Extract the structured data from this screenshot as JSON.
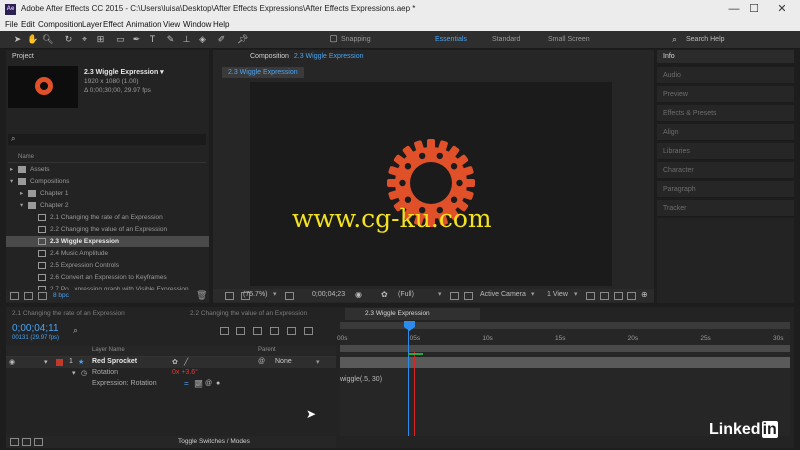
{
  "window": {
    "title": "Adobe After Effects CC 2015 - C:\\Users\\luisa\\Desktop\\After Effects Expressions\\After Effects Expressions.aep *",
    "app_icon": "Ae",
    "controls": [
      "—",
      "☐",
      "✕"
    ]
  },
  "menu": [
    "File",
    "Edit",
    "Composition",
    "Layer",
    "Effect",
    "Animation",
    "View",
    "Window",
    "Help"
  ],
  "toolbar": {
    "snapping_label": "Snapping",
    "workspaces": [
      "Essentials",
      "Standard",
      "Small Screen"
    ],
    "search_help": "Search Help"
  },
  "project": {
    "panel_title": "Project",
    "comp_name": "2.3    Wiggle Expression ▾",
    "comp_size": "1920 x 1080 (1.00)",
    "comp_duration": "Δ 0;00;30;00, 29.97 fps",
    "search_placeholder": "",
    "column_name": "Name",
    "tree": [
      {
        "label": "Assets",
        "indent": 0,
        "arrow": "▸",
        "kind": "folder"
      },
      {
        "label": "Compositions",
        "indent": 0,
        "arrow": "▾",
        "kind": "folder"
      },
      {
        "label": "Chapter 1",
        "indent": 1,
        "arrow": "▸",
        "kind": "folder"
      },
      {
        "label": "Chapter 2",
        "indent": 1,
        "arrow": "▾",
        "kind": "folder"
      },
      {
        "label": "2.1   Changing the rate of an Expression",
        "indent": 2,
        "arrow": "",
        "kind": "comp"
      },
      {
        "label": "2.2   Changing the value of an Expression",
        "indent": 2,
        "arrow": "",
        "kind": "comp"
      },
      {
        "label": "2.3   Wiggle Expression",
        "indent": 2,
        "arrow": "",
        "kind": "comp",
        "selected": true
      },
      {
        "label": "2.4   Music Amplitude",
        "indent": 2,
        "arrow": "",
        "kind": "comp"
      },
      {
        "label": "2.5   Expression Controls",
        "indent": 2,
        "arrow": "",
        "kind": "comp"
      },
      {
        "label": "2.6   Convert an Expression to Keyframes",
        "indent": 2,
        "arrow": "",
        "kind": "comp"
      },
      {
        "label": "2.7   Po...xpressing graph with Visible Expression",
        "indent": 2,
        "arrow": "",
        "kind": "comp"
      }
    ],
    "bpc": "8 bpc"
  },
  "composition": {
    "panel_label": "Composition",
    "panel_comp": "2.3  Wiggle Expression",
    "subtab": "2.3  Wiggle Expression",
    "zoom": "(75.7%)",
    "timecode": "0;00;04;23",
    "resolution": "(Full)",
    "camera": "Active Camera",
    "view": "1 View",
    "watermark": "www.cg-ku.com"
  },
  "side_panels": [
    "Info",
    "Audio",
    "Preview",
    "Effects & Presets",
    "Align",
    "Libraries",
    "Character",
    "Paragraph",
    "Tracker"
  ],
  "timeline": {
    "tabs": [
      "2.1  Changing the rate of an Expression",
      "2.2  Changing the value of an Expression",
      "2.3  Wiggle Expression"
    ],
    "current_time": "0;00;04;11",
    "frame_info": "00131 (29.97 fps)",
    "col_layer_name": "Layer Name",
    "col_parent": "Parent",
    "layer_index": "1",
    "layer_name": "Red Sprocket",
    "parent_value": "None",
    "prop_rotation": "Rotation",
    "rotation_value": "0x +3.6°",
    "prop_expression": "Expression: Rotation",
    "expression_text": "wiggle(.5, 30)",
    "ruler": [
      "00s",
      "05s",
      "10s",
      "15s",
      "20s",
      "25s",
      "30s"
    ],
    "toggle_label": "Toggle Switches / Modes"
  },
  "brand": {
    "linkedin": "Linked",
    "linkedin_in": "in"
  },
  "colors": {
    "accent_blue": "#2d8ceb",
    "sprocket": "#e0512a",
    "playhead": "#d6252b",
    "comp_bg": "#1b1b1b"
  }
}
